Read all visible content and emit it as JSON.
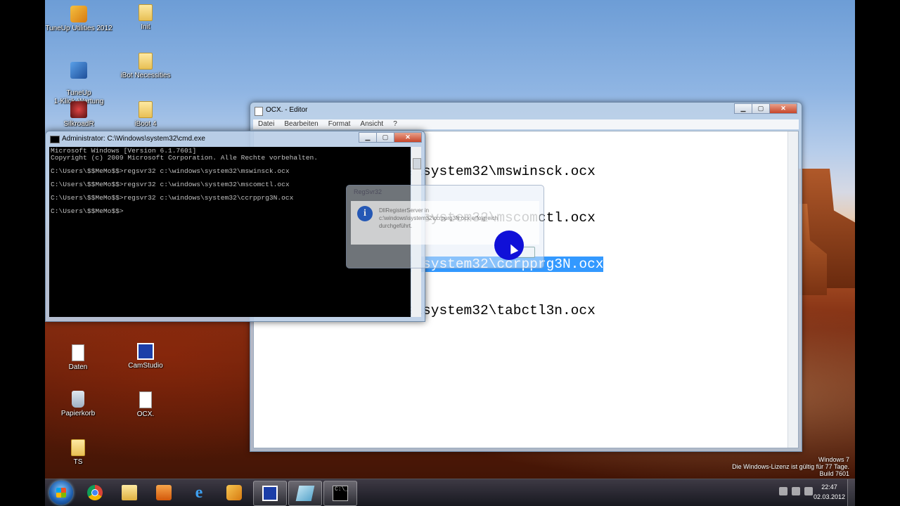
{
  "desktop": {
    "icons": [
      {
        "label": "TuneUp Utilities 2012",
        "icon": "tuneup-icon"
      },
      {
        "label": "Init",
        "icon": "folder-icon"
      },
      {
        "label": "TuneUp\n1-Klick-Wartung",
        "icon": "tuneup-wartung-icon"
      },
      {
        "label": "iBot Necessities",
        "icon": "folder-icon"
      },
      {
        "label": "SilkroadR",
        "icon": "silkroad-icon"
      },
      {
        "label": "iBoot 4",
        "icon": "folder-icon"
      },
      {
        "label": "Daten",
        "icon": "file-icon"
      },
      {
        "label": "CamStudio",
        "icon": "camstudio-icon"
      },
      {
        "label": "Papierkorb",
        "icon": "recycle-bin-icon"
      },
      {
        "label": "OCX.",
        "icon": "file-icon"
      },
      {
        "label": "TS",
        "icon": "folder-icon"
      }
    ]
  },
  "notepad": {
    "title": "OCX. - Editor",
    "menu": [
      "Datei",
      "Bearbeiten",
      "Format",
      "Ansicht",
      "?"
    ],
    "lines": [
      {
        "text": "regsvr32 c:\\windows\\system32\\mswinsck.ocx"
      },
      {
        "text": "regsvr32 c:\\windows\\system32\\mscomctl.ocx"
      },
      {
        "text": "regsvr32 c:\\windows\\system32\\ccrpprg3N.ocx",
        "selected": true
      },
      {
        "text": "regsvr32 c:\\windows\\system32\\tabctl3n.ocx"
      }
    ],
    "buttons": {
      "minimize": "▁",
      "maximize": "▢",
      "close": "✕"
    }
  },
  "cmd": {
    "title": "Administrator: C:\\Windows\\system32\\cmd.exe",
    "output": "Microsoft Windows [Version 6.1.7601]\nCopyright (c) 2009 Microsoft Corporation. Alle Rechte vorbehalten.\n\nC:\\Users\\$$MeMo$$>regsvr32 c:\\windows\\system32\\mswinsck.ocx\n\nC:\\Users\\$$MeMo$$>regsvr32 c:\\windows\\system32\\mscomctl.ocx\n\nC:\\Users\\$$MeMo$$>regsvr32 c:\\windows\\system32\\ccrpprg3N.ocx\n\nC:\\Users\\$$MeMo$$>",
    "buttons": {
      "minimize": "▁",
      "maximize": "▢",
      "close": "✕"
    }
  },
  "dialog": {
    "title": "RegSvr32",
    "message": "DllRegisterServer in c:\\windows\\system32\\ccrpprg3N.ocx erfolgreich durchgeführt.",
    "ok_label": "OK"
  },
  "watermark": {
    "line1": "Windows 7",
    "line2": "Die Windows-Lizenz ist gültig für 77 Tage.",
    "line3": "Build 7601"
  },
  "taskbar": {
    "apps": [
      "chrome-icon",
      "explorer-folder-icon",
      "media-player-icon",
      "internet-explorer-icon",
      "tuneup-icon",
      "camstudio-icon",
      "notepad-icon",
      "cmd-icon"
    ],
    "clock_time": "22:47",
    "clock_date": "02.03.2012",
    "cmd_glyph": "C:\\_"
  }
}
